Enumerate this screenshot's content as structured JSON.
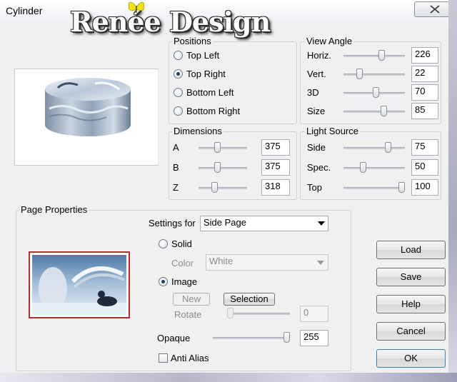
{
  "window": {
    "title": "Cylinder",
    "close_icon": "close-icon"
  },
  "watermark": {
    "text": "Renée Design",
    "icon": "butterfly-icon"
  },
  "positions": {
    "label": "Positions",
    "options": [
      "Top Left",
      "Top Right",
      "Bottom Left",
      "Bottom Right"
    ],
    "selected": "Top Right"
  },
  "view_angle": {
    "label": "View Angle",
    "rows": [
      {
        "label": "Horiz.",
        "value": "226",
        "level": 0.63
      },
      {
        "label": "Vert.",
        "value": "22",
        "level": 0.24
      },
      {
        "label": "3D",
        "value": "70",
        "level": 0.53
      },
      {
        "label": "Size",
        "value": "85",
        "level": 0.68
      }
    ]
  },
  "dimensions": {
    "label": "Dimensions",
    "rows": [
      {
        "label": "A",
        "value": "375",
        "level": 0.37
      },
      {
        "label": "B",
        "value": "375",
        "level": 0.37
      },
      {
        "label": "Z",
        "value": "318",
        "level": 0.31
      }
    ]
  },
  "light_source": {
    "label": "Light Source",
    "rows": [
      {
        "label": "Side",
        "value": "75",
        "level": 0.75
      },
      {
        "label": "Spec.",
        "value": "50",
        "level": 0.3
      },
      {
        "label": "Top",
        "value": "100",
        "level": 1.0
      }
    ]
  },
  "page_properties": {
    "label": "Page Properties",
    "settings_for_label": "Settings for",
    "settings_for_value": "Side Page",
    "solid_label": "Solid",
    "color_label": "Color",
    "color_value": "White",
    "image_label": "Image",
    "image_selected": true,
    "new_label": "New",
    "selection_label": "Selection",
    "rotate_label": "Rotate",
    "rotate_value": "0",
    "rotate_level": 0.0,
    "opaque_label": "Opaque",
    "opaque_value": "255",
    "opaque_level": 1.0,
    "anti_alias_label": "Anti Alias",
    "anti_alias_checked": false
  },
  "buttons": {
    "load": "Load",
    "save": "Save",
    "help": "Help",
    "cancel": "Cancel",
    "ok": "OK"
  },
  "colors": {
    "accent_radio": "#1f3d66",
    "thumbnail_border": "#b03030"
  }
}
